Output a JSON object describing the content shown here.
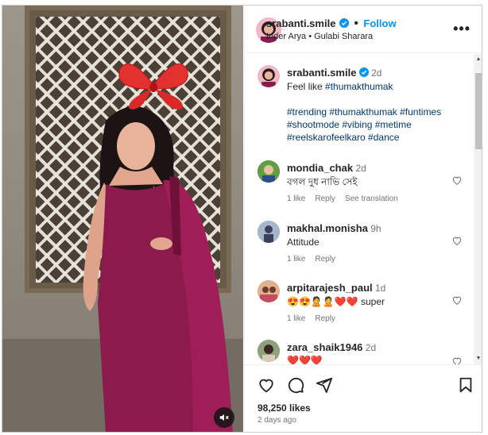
{
  "post": {
    "username": "srabanti.smile",
    "follow_label": "Follow",
    "audio": "Inder Arya • Gulabi Sharara",
    "caption_username": "srabanti.smile",
    "caption_time": "2d",
    "caption_line1": "Feel like ",
    "caption_tag1": "#thumakthumak",
    "hashtags_line1": "#trending #thumakthumak #funtimes",
    "hashtags_line2": "#shootmode #vibing #metime",
    "hashtags_line3": "#reelskarofeelkaro #dance"
  },
  "comments": [
    {
      "username": "mondia_chak",
      "time": "2d",
      "text": "বগল দুধ নাভি সেই",
      "likes": "1 like",
      "reply": "Reply",
      "translate": "See translation"
    },
    {
      "username": "makhal.monisha",
      "time": "9h",
      "text": "Attitude",
      "likes": "1 like",
      "reply": "Reply"
    },
    {
      "username": "arpitarajesh_paul",
      "time": "1d",
      "text": "😍😍🙎🙎❤️❤️ super",
      "likes": "1 like",
      "reply": "Reply"
    },
    {
      "username": "zara_shaik1946",
      "time": "2d",
      "text": "❤️❤️❤️"
    }
  ],
  "footer": {
    "likes": "98,250 likes",
    "posted": "2 days ago"
  },
  "colors": {
    "accent": "#0095f6",
    "hashtag": "#00376b",
    "verified": "#0095f6"
  }
}
